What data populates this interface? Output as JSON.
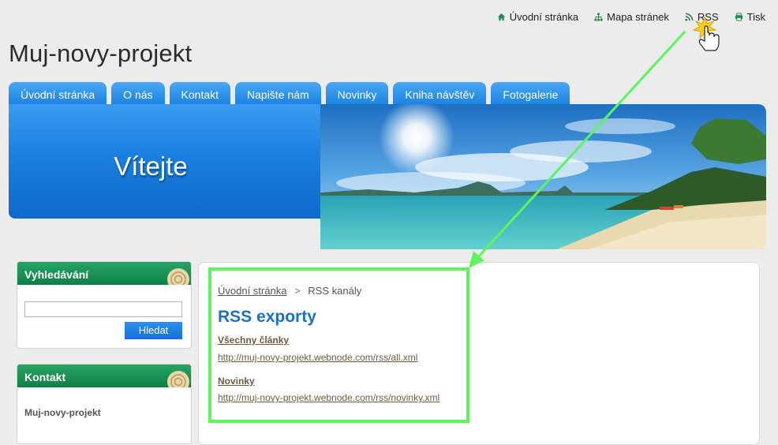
{
  "top_links": [
    {
      "icon": "home-icon",
      "label": "Úvodní stránka"
    },
    {
      "icon": "sitemap-icon",
      "label": "Mapa stránek"
    },
    {
      "icon": "rss-icon",
      "label": "RSS"
    },
    {
      "icon": "print-icon",
      "label": "Tisk"
    }
  ],
  "site_title": "Muj-novy-projekt",
  "nav_tabs": [
    "Úvodní stránka",
    "O nás",
    "Kontakt",
    "Napište nám",
    "Novinky",
    "Kniha návštěv",
    "Fotogalerie"
  ],
  "hero": {
    "welcome": "Vítejte"
  },
  "sidebar": {
    "search": {
      "title": "Vyhledávání",
      "input_value": "",
      "button_label": "Hledat"
    },
    "contact": {
      "title": "Kontakt",
      "name": "Muj-novy-projekt"
    }
  },
  "breadcrumb": {
    "home": "Úvodní stránka",
    "separator": ">",
    "current": "RSS kanály"
  },
  "content": {
    "heading": "RSS exporty",
    "feeds": [
      {
        "title": "Všechny články",
        "url": "http://muj-novy-projekt.webnode.com/rss/all.xml"
      },
      {
        "title": "Novinky",
        "url": "http://muj-novy-projekt.webnode.com/rss/novinky.xml"
      }
    ]
  },
  "colors": {
    "accent_blue": "#1c84e4",
    "sidebar_green": "#0f7f48",
    "highlight_green": "#5cf65c",
    "link_brown": "#6e5c3f"
  }
}
